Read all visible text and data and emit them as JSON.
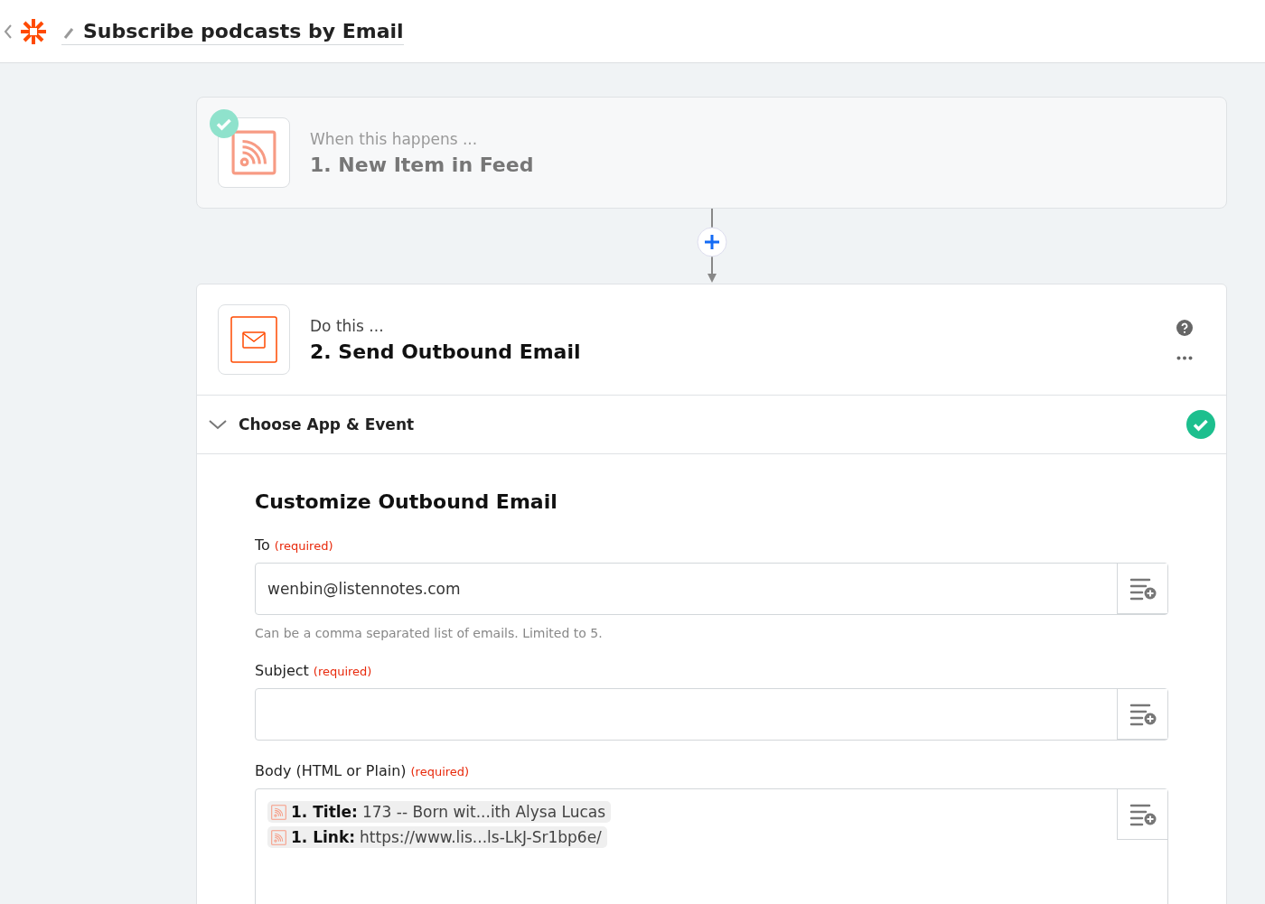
{
  "header": {
    "title": "Subscribe podcasts by Email"
  },
  "steps": [
    {
      "kind": "trigger",
      "caption": "When this happens ...",
      "title": "1. New Item in Feed",
      "done": true,
      "active": false
    },
    {
      "kind": "action",
      "caption": "Do this ...",
      "title": "2. Send Outbound Email",
      "done": false,
      "active": true
    }
  ],
  "section": {
    "title": "Choose App & Event",
    "complete": true
  },
  "form": {
    "title": "Customize Outbound Email",
    "fields": [
      {
        "label": "To",
        "required": "(required)",
        "value": "wenbin@listennotes.com",
        "hint": "Can be a comma separated list of emails. Limited to 5."
      },
      {
        "label": "Subject",
        "required": "(required)"
      },
      {
        "label": "Body (HTML or Plain)",
        "required": "(required)",
        "pills": [
          {
            "label": "1. Title:",
            "value": "173 -- Born wit...ith Alysa Lucas"
          },
          {
            "label": "1. Link:",
            "value": "https://www.lis...ls-LkJ-Sr1bp6e/"
          }
        ]
      }
    ]
  }
}
